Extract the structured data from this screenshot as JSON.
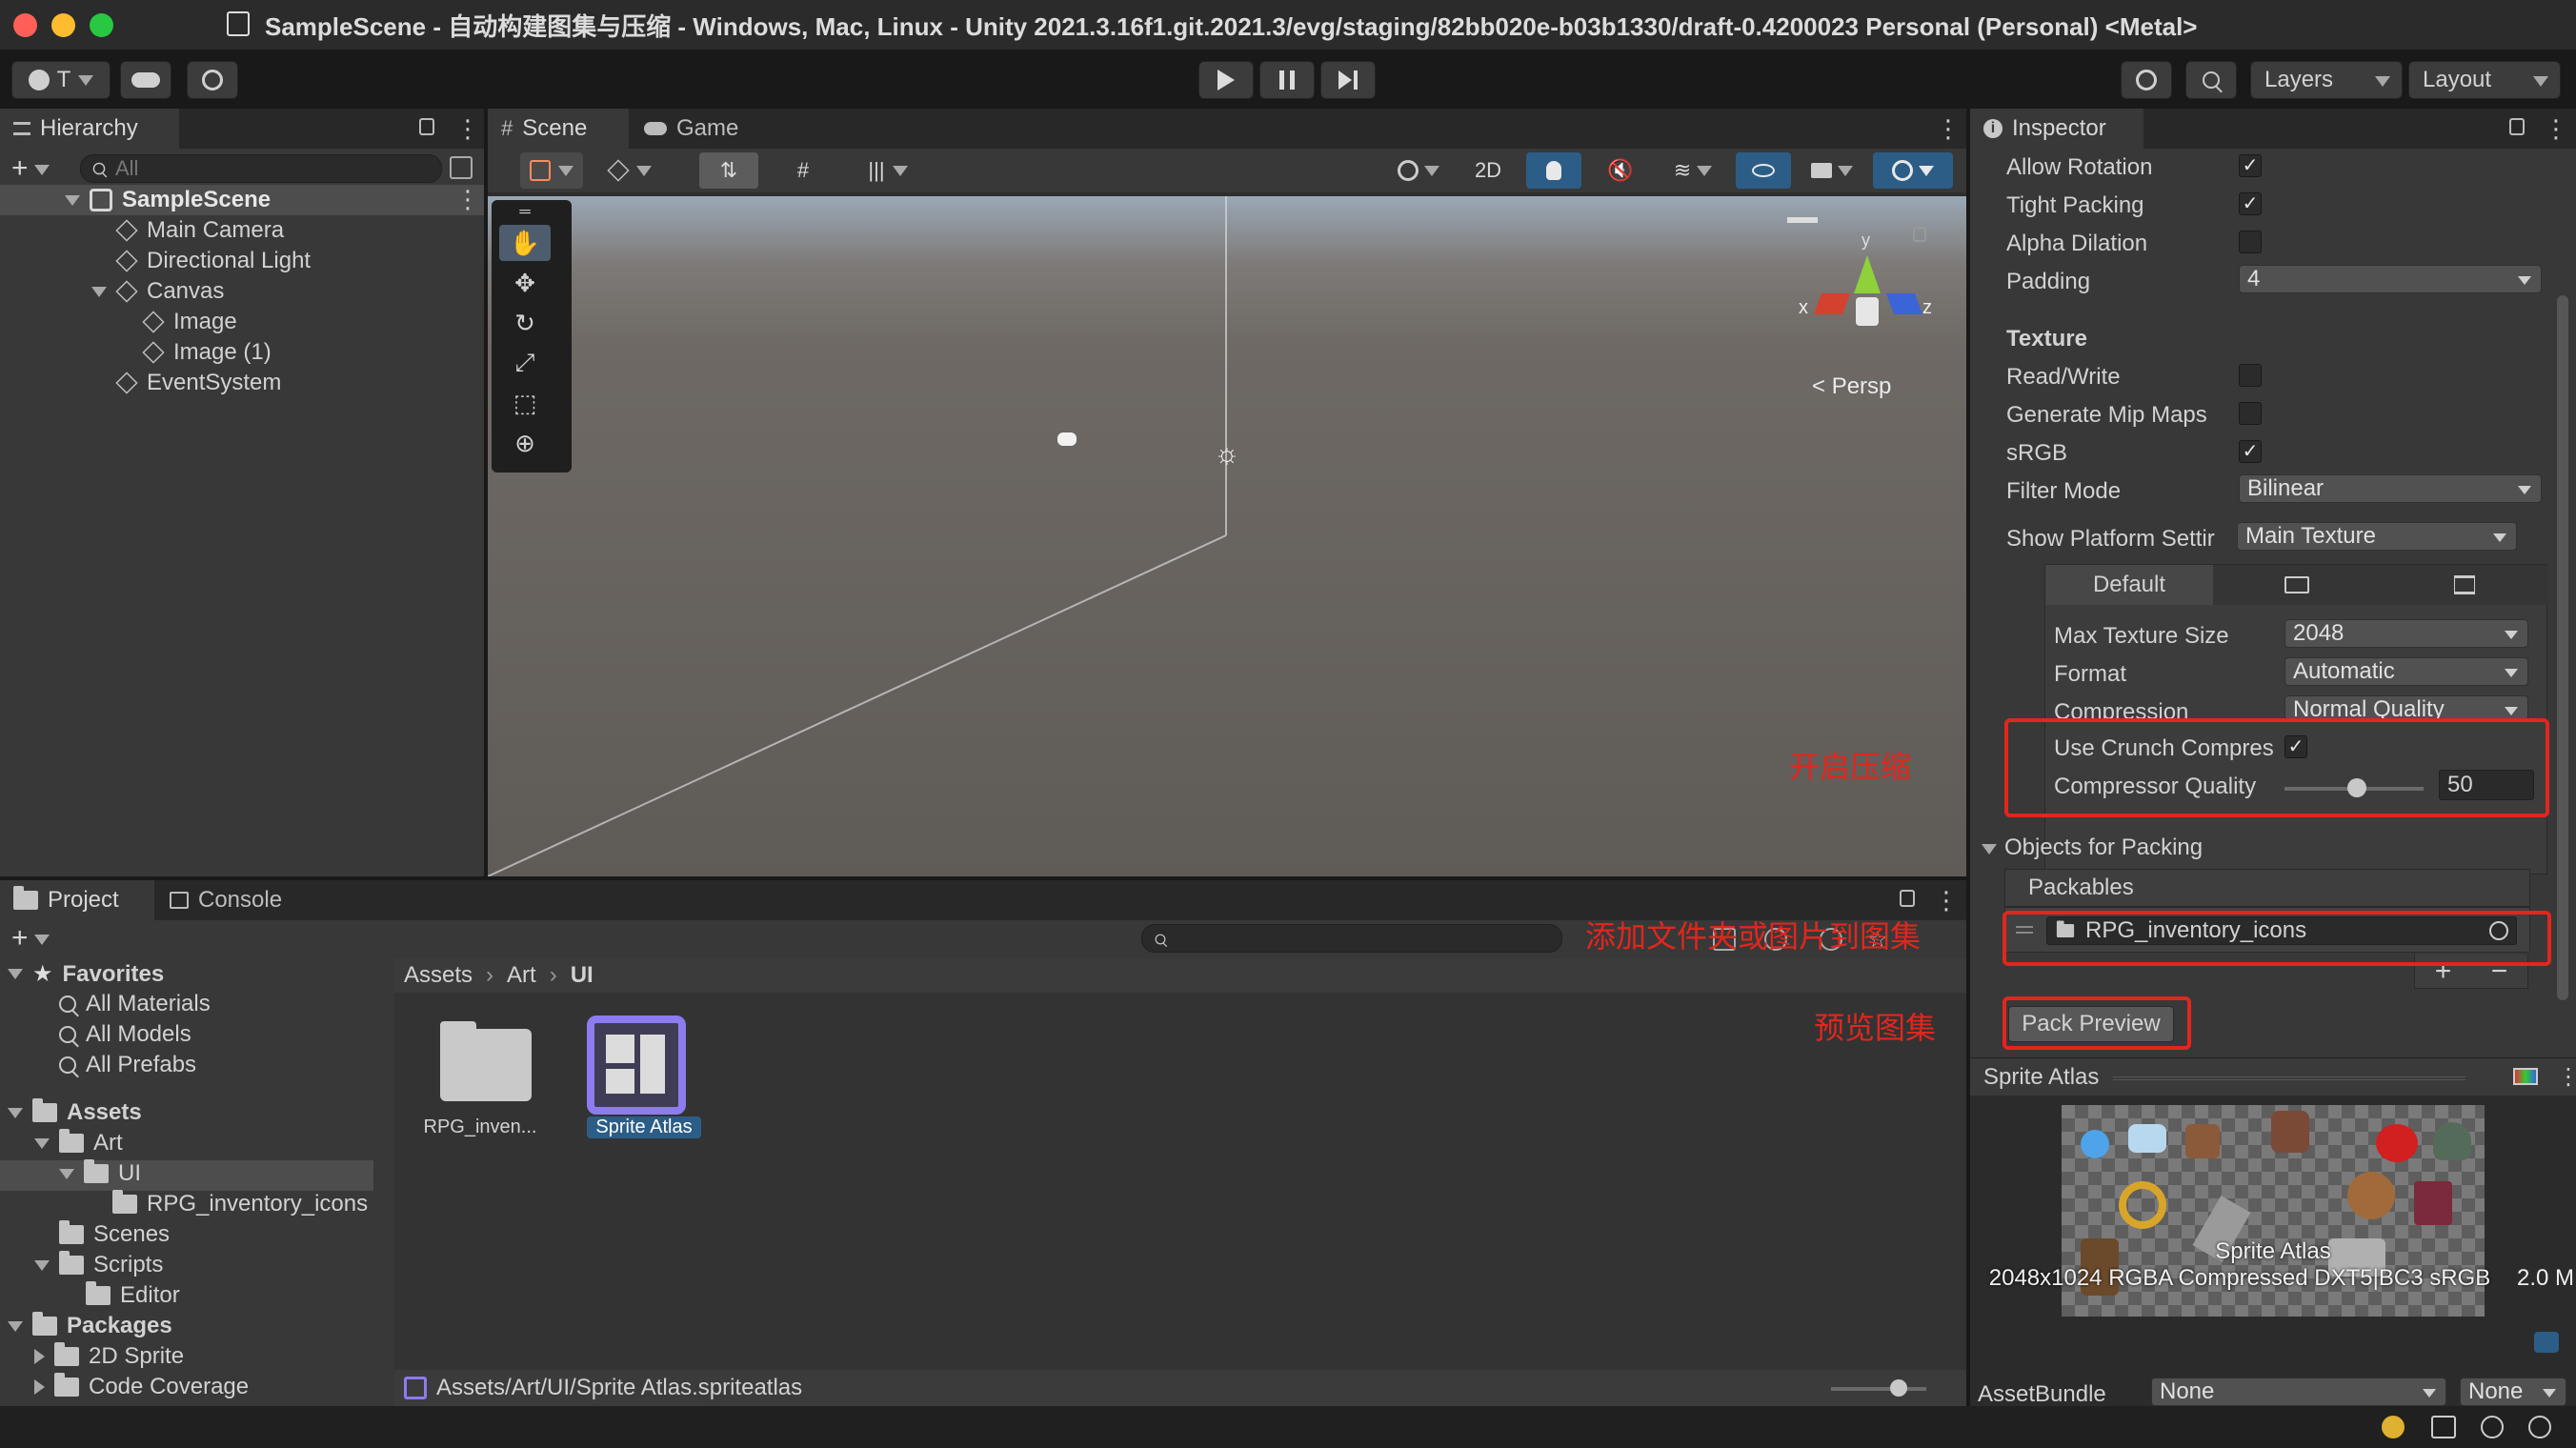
{
  "window": {
    "title": "SampleScene - 自动构建图集与压缩 - Windows, Mac, Linux - Unity 2021.3.16f1.git.2021.3/evg/staging/82bb020e-b03b1330/draft-0.4200023 Personal (Personal) <Metal>"
  },
  "toolbar": {
    "account_label": "T",
    "layers_label": "Layers",
    "layout_label": "Layout"
  },
  "hierarchy": {
    "tab": "Hierarchy",
    "search_placeholder": "All",
    "scene": "SampleScene",
    "items": [
      "Main Camera",
      "Directional Light",
      "Canvas",
      "Image",
      "Image (1)",
      "EventSystem"
    ]
  },
  "scene_view": {
    "tab_scene": "Scene",
    "tab_game": "Game",
    "btn_2d": "2D",
    "persp_label": "Persp",
    "gizmo_x": "x",
    "gizmo_y": "y",
    "gizmo_z": "z"
  },
  "inspector": {
    "tab": "Inspector",
    "allow_rotation": {
      "label": "Allow Rotation",
      "checked": true
    },
    "tight_packing": {
      "label": "Tight Packing",
      "checked": true
    },
    "alpha_dilation": {
      "label": "Alpha Dilation",
      "checked": false
    },
    "padding": {
      "label": "Padding",
      "value": "4"
    },
    "texture_header": "Texture",
    "read_write": {
      "label": "Read/Write",
      "checked": false
    },
    "mipmaps": {
      "label": "Generate Mip Maps",
      "checked": false
    },
    "srgb": {
      "label": "sRGB",
      "checked": true
    },
    "filter_mode": {
      "label": "Filter Mode",
      "value": "Bilinear"
    },
    "platform_settings": {
      "label": "Show Platform Settir",
      "value": "Main Texture"
    },
    "platform_tab_default": "Default",
    "max_texture_size": {
      "label": "Max Texture Size",
      "value": "2048"
    },
    "format": {
      "label": "Format",
      "value": "Automatic"
    },
    "compression": {
      "label": "Compression",
      "value": "Normal Quality"
    },
    "use_crunch": {
      "label": "Use Crunch Compres",
      "checked": true
    },
    "compressor_quality": {
      "label": "Compressor Quality",
      "value": "50",
      "fraction": 0.5
    },
    "objects_for_packing": "Objects for Packing",
    "packables": "Packables",
    "packable_item": "RPG_inventory_icons",
    "pack_preview": "Pack Preview",
    "sprite_atlas_header": "Sprite Atlas",
    "preview_label": "Sprite Atlas",
    "preview_info": "2048x1024 RGBA Compressed DXT5|BC3 sRGB",
    "preview_size": "2.0 M",
    "assetbundle_label": "AssetBundle",
    "assetbundle_value": "None",
    "assetbundle_variant": "None"
  },
  "annotations": {
    "enable_compression": "开启压缩",
    "add_folder": "添加文件夹或图片到图集",
    "preview_atlas": "预览图集"
  },
  "project": {
    "tab_project": "Project",
    "tab_console": "Console",
    "favorites": "Favorites",
    "fav_items": [
      "All Materials",
      "All Models",
      "All Prefabs"
    ],
    "assets": "Assets",
    "tree": {
      "art": "Art",
      "ui": "UI",
      "rpg": "RPG_inventory_icons",
      "scenes": "Scenes",
      "scripts": "Scripts",
      "editor": "Editor"
    },
    "packages": "Packages",
    "pkg_items": [
      "2D Sprite",
      "Code Coverage"
    ],
    "breadcrumb": [
      "Assets",
      "Art",
      "UI"
    ],
    "grid_items": [
      "RPG_inven...",
      "Sprite Atlas"
    ],
    "status_path": "Assets/Art/UI/Sprite Atlas.spriteatlas"
  },
  "colors": {
    "accent_blue": "#2c5d87",
    "annotation_red": "#e2261d",
    "atlas_purple": "#8c7cf0"
  }
}
